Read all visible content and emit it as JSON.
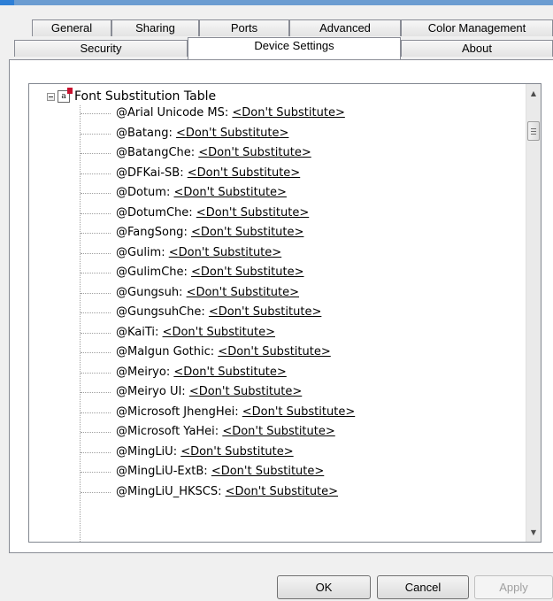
{
  "tabs": {
    "row1": [
      "General",
      "Sharing",
      "Ports",
      "Advanced",
      "Color Management"
    ],
    "row2": [
      "Security",
      "Device Settings",
      "About"
    ],
    "active": "Device Settings"
  },
  "tree": {
    "root_label": "Font Substitution Table",
    "items": [
      {
        "name": "@Arial Unicode MS: ",
        "value": "<Don't Substitute>"
      },
      {
        "name": "@Batang: ",
        "value": "<Don't Substitute>"
      },
      {
        "name": "@BatangChe: ",
        "value": "<Don't Substitute>"
      },
      {
        "name": "@DFKai-SB: ",
        "value": "<Don't Substitute>"
      },
      {
        "name": "@Dotum: ",
        "value": "<Don't Substitute>"
      },
      {
        "name": "@DotumChe: ",
        "value": "<Don't Substitute>"
      },
      {
        "name": "@FangSong: ",
        "value": "<Don't Substitute>"
      },
      {
        "name": "@Gulim: ",
        "value": "<Don't Substitute>"
      },
      {
        "name": "@GulimChe: ",
        "value": "<Don't Substitute>"
      },
      {
        "name": "@Gungsuh: ",
        "value": "<Don't Substitute>"
      },
      {
        "name": "@GungsuhChe: ",
        "value": "<Don't Substitute>"
      },
      {
        "name": "@KaiTi: ",
        "value": "<Don't Substitute>"
      },
      {
        "name": "@Malgun Gothic: ",
        "value": "<Don't Substitute>"
      },
      {
        "name": "@Meiryo: ",
        "value": "<Don't Substitute>"
      },
      {
        "name": "@Meiryo UI: ",
        "value": "<Don't Substitute>"
      },
      {
        "name": "@Microsoft JhengHei: ",
        "value": "<Don't Substitute>"
      },
      {
        "name": "@Microsoft YaHei: ",
        "value": "<Don't Substitute>"
      },
      {
        "name": "@MingLiU: ",
        "value": "<Don't Substitute>"
      },
      {
        "name": "@MingLiU-ExtB: ",
        "value": "<Don't Substitute>"
      },
      {
        "name": "@MingLiU_HKSCS: ",
        "value": "<Don't Substitute>"
      }
    ]
  },
  "buttons": {
    "ok": "OK",
    "cancel": "Cancel",
    "apply": "Apply"
  },
  "colors": {
    "title_bar": "#6b9cd1",
    "panel": "#ffffff",
    "background": "#f0f0f0"
  }
}
